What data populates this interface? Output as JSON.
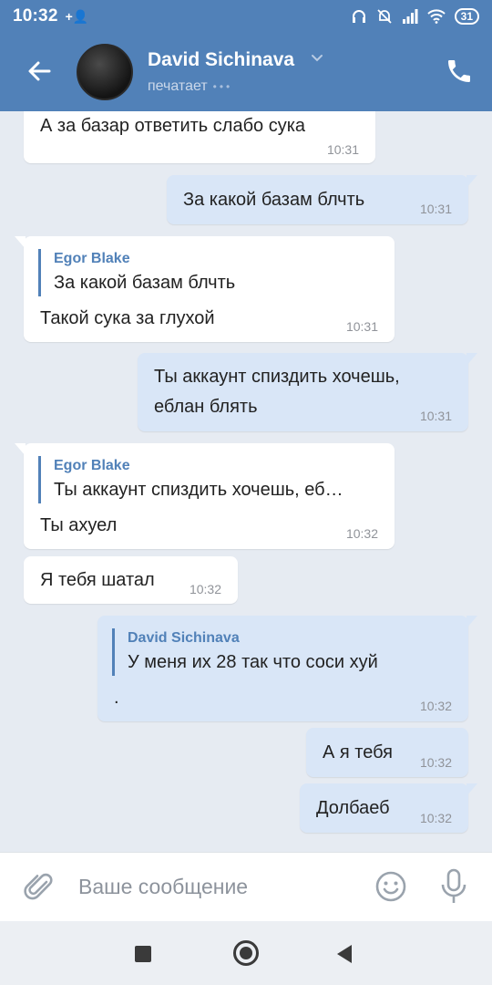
{
  "status": {
    "time": "10:32",
    "battery": "31"
  },
  "header": {
    "name": "David Sichinava",
    "status": "печатает",
    "dots": "•••"
  },
  "messages": [
    {
      "text": "А за базар ответить слабо сука",
      "time": "10:31"
    },
    {
      "text": "За какой базам блчть",
      "time": "10:31"
    },
    {
      "reply_author": "Egor Blake",
      "reply_text": "За какой базам блчть",
      "text": "Такой сука за глухой",
      "time": "10:31"
    },
    {
      "line1": "Ты аккаунт спиздить хочешь,",
      "line2": "еблан блять",
      "time": "10:31"
    },
    {
      "reply_author": "Egor Blake",
      "reply_text": "Ты аккаунт спиздить хочешь, еб…",
      "text": "Ты ахуел",
      "time": "10:32"
    },
    {
      "text": "Я тебя шатал",
      "time": "10:32"
    },
    {
      "reply_author": "David Sichinava",
      "reply_text": "У меня их 28 так что соси хуй",
      "text": ".",
      "time": "10:32"
    },
    {
      "text": "А я тебя",
      "time": "10:32"
    },
    {
      "text": "Долбаеб",
      "time": "10:32"
    }
  ],
  "input": {
    "placeholder": "Ваше сообщение"
  },
  "colors": {
    "header": "#5181b8",
    "incoming": "#ffffff",
    "outgoing": "#d9e6f7",
    "background": "#e6ebf2",
    "accent": "#5181b8"
  }
}
